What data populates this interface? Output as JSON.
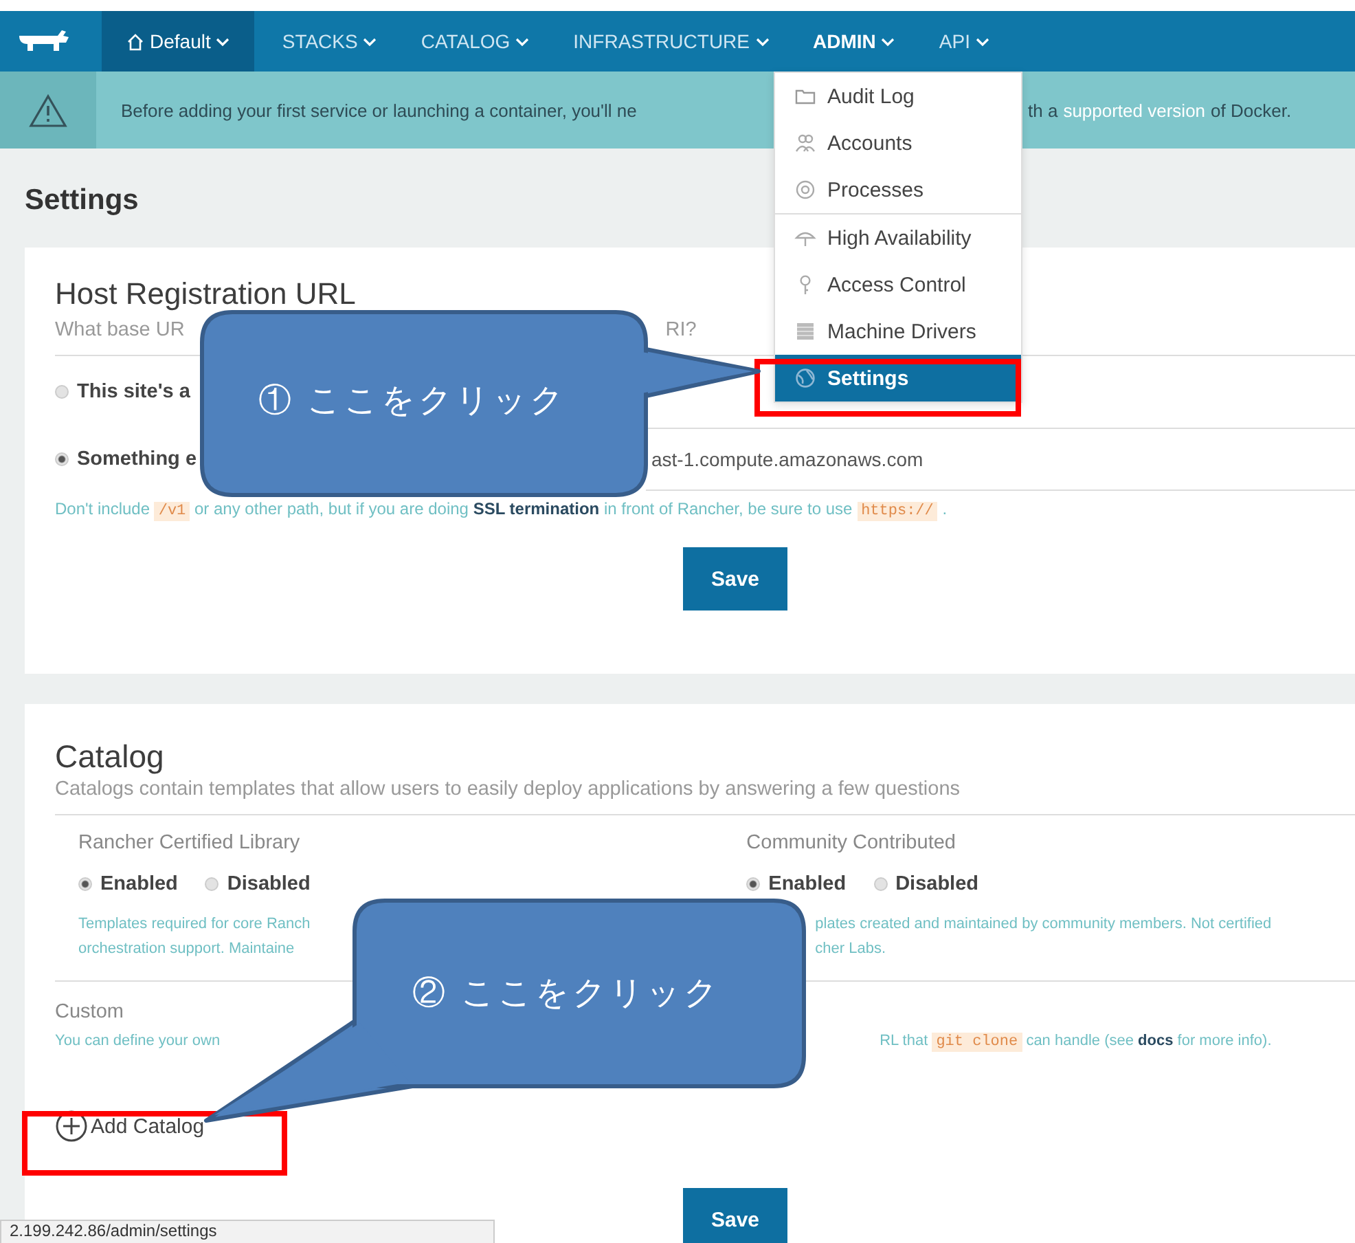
{
  "navbar": {
    "items": [
      {
        "label": "Default",
        "kind": "environment",
        "selected": false
      },
      {
        "label": "STACKS",
        "kind": "menu",
        "selected": false
      },
      {
        "label": "CATALOG",
        "kind": "menu",
        "selected": false
      },
      {
        "label": "INFRASTRUCTURE",
        "kind": "menu",
        "selected": false
      },
      {
        "label": "ADMIN",
        "kind": "menu",
        "selected": true
      },
      {
        "label": "API",
        "kind": "menu",
        "selected": false
      }
    ]
  },
  "banner": {
    "text_before": "Before adding your first service or launching a container, you'll ne",
    "text_after": "th a",
    "link": "supported version",
    "text_end": "of Docker."
  },
  "page_title": "Settings",
  "host_registration": {
    "title": "Host Registration URL",
    "subtitle_start": "What base UR",
    "subtitle_end": "RI?",
    "options": [
      {
        "label": "This site's a",
        "selected": false
      },
      {
        "label": "Something e",
        "selected": true
      }
    ],
    "input_value": "ast-1.compute.amazonaws.com",
    "help": [
      {
        "kind": "text",
        "text": "Don't include"
      },
      {
        "kind": "code",
        "text": "/v1"
      },
      {
        "kind": "text",
        "text": "or any other path, but if you are doing"
      },
      {
        "kind": "strong",
        "text": "SSL termination"
      },
      {
        "kind": "text",
        "text": "in front of Rancher, be sure to use"
      },
      {
        "kind": "code",
        "text": "https://"
      },
      {
        "kind": "text",
        "text": "."
      }
    ],
    "save": "Save"
  },
  "catalog": {
    "title": "Catalog",
    "subtitle": "Catalogs contain templates that allow users to easily deploy applications by answering a few questions",
    "libraries": [
      {
        "name": "Rancher Certified Library",
        "options": [
          {
            "label": "Enabled",
            "selected": true
          },
          {
            "label": "Disabled",
            "selected": false
          }
        ],
        "help": [
          "Templates required for core Ranch",
          "orchestration support. Maintaine"
        ]
      },
      {
        "name": "Community Contributed",
        "options": [
          {
            "label": "Enabled",
            "selected": true
          },
          {
            "label": "Disabled",
            "selected": false
          }
        ],
        "help": [
          "plates created and maintained by community members. Not certified",
          "cher Labs."
        ]
      }
    ],
    "custom_title": "Custom",
    "custom_help_start": "You can define your own",
    "custom_help_end": [
      {
        "kind": "text",
        "text": "RL that"
      },
      {
        "kind": "code",
        "text": "git clone"
      },
      {
        "kind": "text",
        "text": "can handle (see"
      },
      {
        "kind": "strong",
        "text": "docs"
      },
      {
        "kind": "text",
        "text": "for more info)."
      }
    ],
    "add_button": "Add Catalog",
    "save": "Save"
  },
  "admin_menu": {
    "items": [
      {
        "label": "Audit Log",
        "kind": "folder",
        "selected": false
      },
      {
        "label": "Accounts",
        "kind": "users",
        "selected": false
      },
      {
        "label": "Processes",
        "kind": "gear",
        "selected": false
      },
      {
        "label": "High Availability",
        "kind": "umbrella",
        "selected": false
      },
      {
        "label": "Access Control",
        "kind": "key",
        "selected": false
      },
      {
        "label": "Machine Drivers",
        "kind": "list",
        "selected": false
      },
      {
        "label": "Settings",
        "kind": "globe",
        "selected": true
      }
    ]
  },
  "status_url": "2.199.242.86/admin/settings",
  "annotations": [
    {
      "text": "① ここをクリック"
    },
    {
      "text": "② ここをクリック"
    }
  ]
}
